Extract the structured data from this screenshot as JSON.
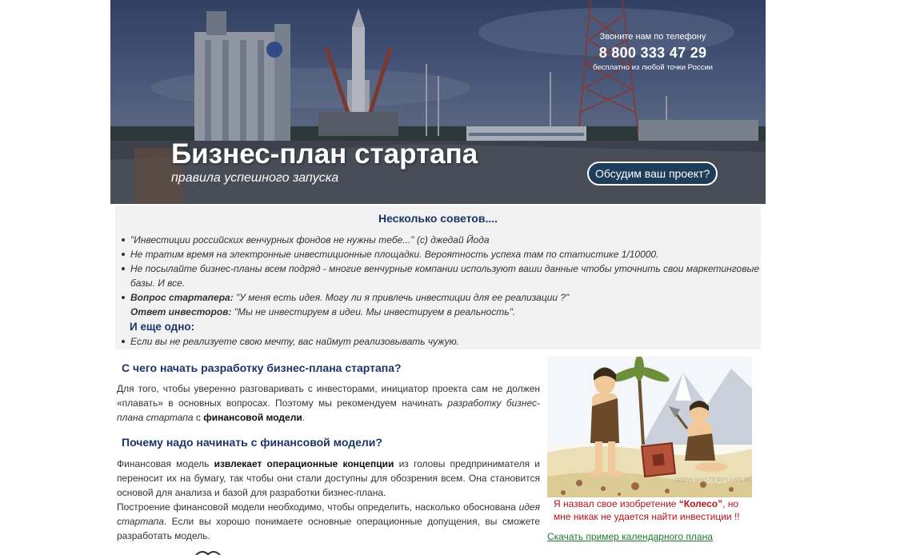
{
  "hero": {
    "title": "Бизнес-план стартапа",
    "subtitle": "правила успешного запуска",
    "phone_caption": "Звоните нам по телефону",
    "phone_number": "8 800 333 47 29",
    "phone_note": "бесплатно из любой точки России",
    "cta_label": "Обсудим ваш проект?"
  },
  "tips": {
    "heading": "Несколько советов....",
    "items": [
      {
        "text": "\"Инвестиции российских венчурных фондов не нужны тебе...\"   (с) джедай Йода"
      },
      {
        "text": "Не тратим время на электронные инвестиционные площадки. Вероятность успеха там по статистике 1/10000."
      },
      {
        "text": "Не посылайте бизнес-планы всем подряд - многие венчурные компании используют ваши данные чтобы уточнить свои маркетинговые базы. И все."
      }
    ],
    "qa": {
      "question_label": "Вопрос стартапера:",
      "question_text": " \"У меня есть идея. Могу ли я привлечь инвестиции  для ее реализации ?\"",
      "answer_label": "Ответ инвесторов:",
      "answer_text": " \"Мы не инвестируем в идеи. Мы инвестируем в реальность\"."
    },
    "heading2": "И еще одно:",
    "last_item": "Если вы не реализуете свою мечту, вас наймут реализовывать чужую."
  },
  "article": {
    "section1_heading": "С чего начать разработку бизнес-плана стартапа?",
    "section1_part1": "Для того, чтобы уверенно разговаривать с инвесторами, инициатор проекта сам не должен «плавать» в основных вопросах. Поэтому мы рекомендуем начинать ",
    "section1_italic": "разработку бизнес-плана стартапа",
    "section1_part2": " с ",
    "section1_bold": "финансовой модели",
    "section1_end": ".",
    "section2_heading": "Почему надо начинать с финансовой модели?",
    "section2_p1_a": "Финансовая модель ",
    "section2_p1_bold": "извлекает операционные концепции",
    "section2_p1_b": " из головы предпринимателя и переносит их на бумагу, так чтобы они стали доступны для обозрения всем. Она становится основой для анализа и базой для разработки бизнес-плана.",
    "section2_p2_a": "Построение финансовой модели необходимо, чтобы определить, насколько обоснована ",
    "section2_p2_italic": "идея стартапа",
    "section2_p2_b": ". Если вы хорошо понимаете основные операционные допущения, вы сможете разработать модель."
  },
  "cartoon": {
    "caption_a": "Я назвал свое изобретение ",
    "caption_bold": "“Колесо”",
    "caption_b": ", но мне никак не удается найти инвестиции !!",
    "watermark": "WWW.MASTERPLANS.RU"
  },
  "download_link": "Скачать пример календарного плана"
}
